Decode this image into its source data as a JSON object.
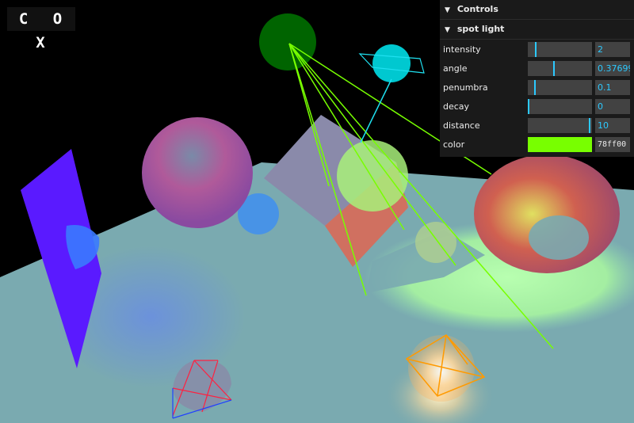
{
  "logo": "C O X",
  "gui": {
    "title": "Controls",
    "folder": "spot light",
    "rows": [
      {
        "label": "intensity",
        "value": "2",
        "fraction": 0.12
      },
      {
        "label": "angle",
        "value": "0.376991",
        "fraction": 0.4
      },
      {
        "label": "penumbra",
        "value": "0.1",
        "fraction": 0.1
      },
      {
        "label": "decay",
        "value": "0",
        "fraction": 0.0
      },
      {
        "label": "distance",
        "value": "10",
        "fraction": 0.98
      }
    ],
    "color_label": "color",
    "color_hex": "78ff00",
    "color_value": "#78ff00",
    "accent": "#2cc9ff"
  }
}
